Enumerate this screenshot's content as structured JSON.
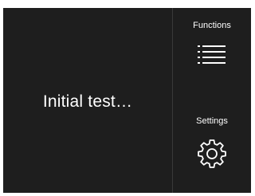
{
  "main": {
    "status_text": "Initial test…"
  },
  "sidebar": {
    "functions_label": "Functions",
    "functions_icon": "list-icon",
    "settings_label": "Settings",
    "settings_icon": "gear-icon"
  },
  "colors": {
    "background": "#1e1e1e",
    "foreground": "#ffffff",
    "divider": "#3a3a3a"
  }
}
